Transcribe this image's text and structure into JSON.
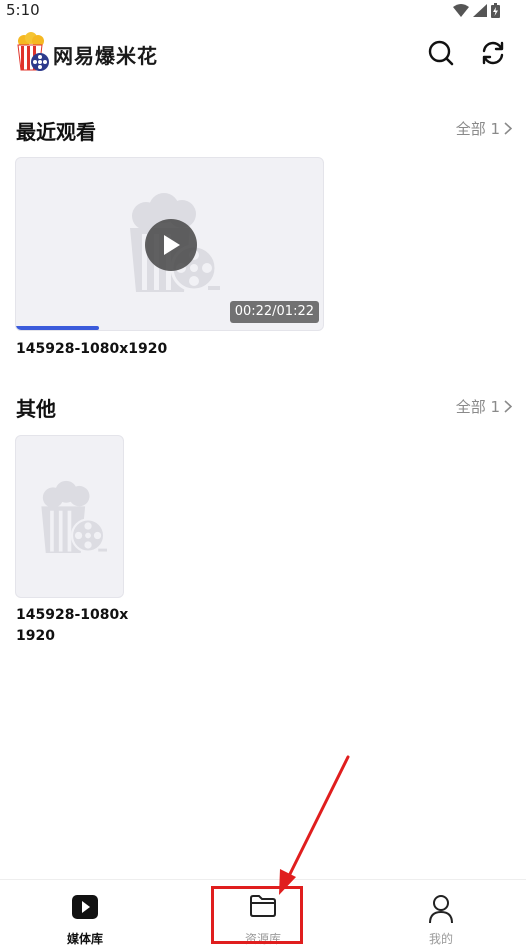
{
  "status_bar": {
    "time": "5:10"
  },
  "header": {
    "title": "网易爆米花"
  },
  "recent": {
    "title": "最近观看",
    "more": "全部 1",
    "item": {
      "name": "145928-1080x1920",
      "duration": "00:22/01:22",
      "progress": 0.27
    }
  },
  "others": {
    "title": "其他",
    "more": "全部 1",
    "item": {
      "name_line1": "145928-1080x",
      "name_line2": "1920"
    }
  },
  "tabbar": {
    "tabs": [
      {
        "label": "媒体库",
        "icon": "play-square-icon",
        "active": true
      },
      {
        "label": "资源库",
        "icon": "folder-icon",
        "active": false
      },
      {
        "label": "我的",
        "icon": "person-icon",
        "active": false
      }
    ]
  },
  "colors": {
    "accent": "#3b5bdb",
    "annotation": "#e01e1e"
  }
}
